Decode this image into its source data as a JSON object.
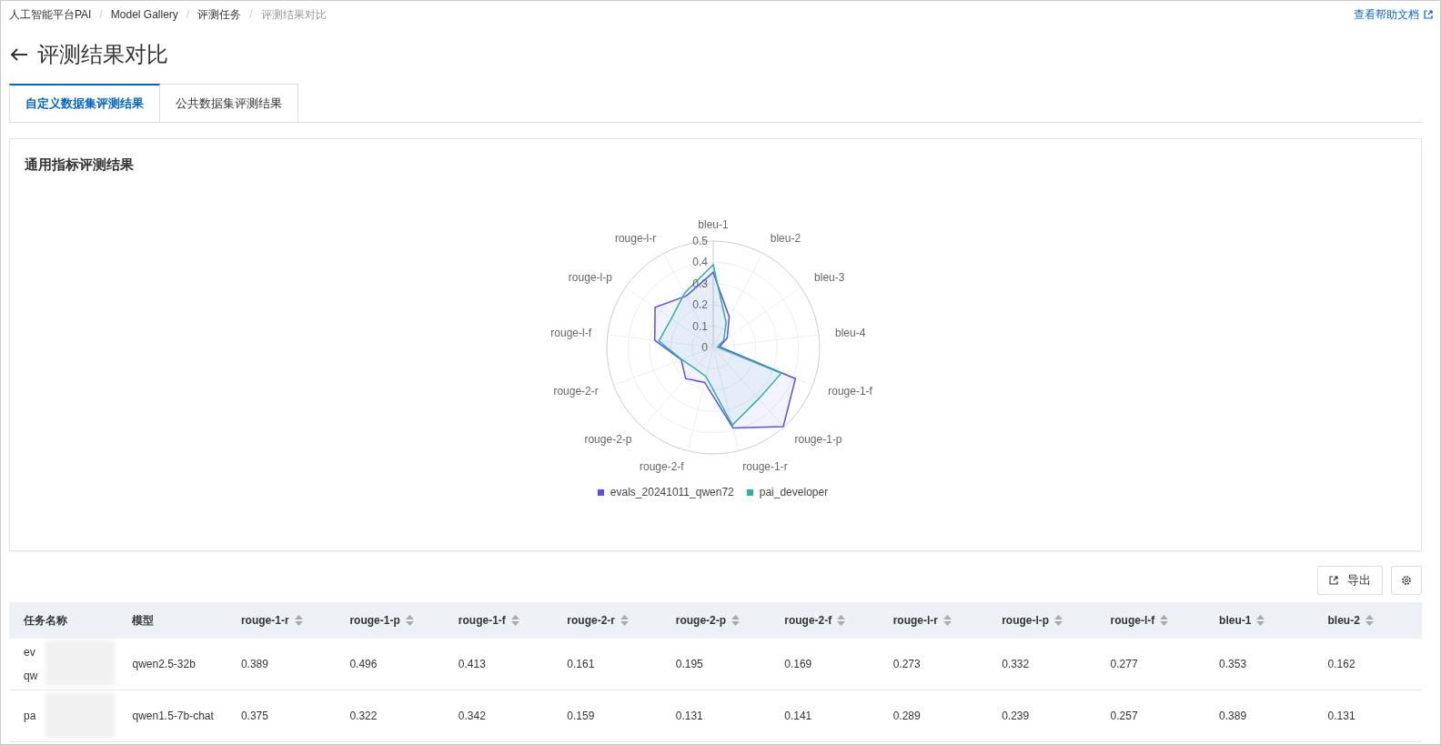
{
  "breadcrumb_separator": "/",
  "breadcrumb": [
    {
      "label": "人工智能平台PAI"
    },
    {
      "label": "Model Gallery"
    },
    {
      "label": "评测任务"
    },
    {
      "label": "评测结果对比"
    }
  ],
  "help_link": "查看帮助文档",
  "page_title": "评测结果对比",
  "tabs": [
    {
      "label": "自定义数据集评测结果",
      "selected": true
    },
    {
      "label": "公共数据集评测结果",
      "selected": false
    }
  ],
  "card": {
    "title": "通用指标评测结果",
    "chart_data": {
      "type": "radar",
      "legend": "bottom",
      "categories": [
        "bleu-1",
        "bleu-2",
        "bleu-3",
        "bleu-4",
        "rouge-1-f",
        "rouge-1-p",
        "rouge-1-r",
        "rouge-2-f",
        "rouge-2-p",
        "rouge-2-r",
        "rouge-l-f",
        "rouge-l-p",
        "rouge-l-r"
      ],
      "ylim": [
        0,
        0.5
      ],
      "yticks": [
        0,
        0.1,
        0.2,
        0.3,
        0.4,
        0.5
      ],
      "series": [
        {
          "name": "evals_20241011_qwen72",
          "color": "#5b4ff0",
          "values": [
            0.353,
            0.162,
            0.08,
            0.03,
            0.413,
            0.496,
            0.389,
            0.169,
            0.195,
            0.161,
            0.277,
            0.332,
            0.273
          ]
        },
        {
          "name": "pai_developer",
          "color": "#2fb0a4",
          "values": [
            0.389,
            0.131,
            0.06,
            0.02,
            0.342,
            0.322,
            0.375,
            0.141,
            0.131,
            0.159,
            0.257,
            0.239,
            0.289
          ]
        }
      ]
    }
  },
  "toolbar": {
    "export_label": "导出"
  },
  "table": {
    "columns": [
      {
        "label": "任务名称",
        "sortable": false
      },
      {
        "label": "模型",
        "sortable": false
      },
      {
        "label": "rouge-1-r",
        "sortable": true
      },
      {
        "label": "rouge-1-p",
        "sortable": true
      },
      {
        "label": "rouge-1-f",
        "sortable": true
      },
      {
        "label": "rouge-2-r",
        "sortable": true
      },
      {
        "label": "rouge-2-p",
        "sortable": true
      },
      {
        "label": "rouge-2-f",
        "sortable": true
      },
      {
        "label": "rouge-l-r",
        "sortable": true
      },
      {
        "label": "rouge-l-p",
        "sortable": true
      },
      {
        "label": "rouge-l-f",
        "sortable": true
      },
      {
        "label": "bleu-1",
        "sortable": true
      },
      {
        "label": "bleu-2",
        "sortable": true
      }
    ],
    "rows": [
      {
        "task_lines": [
          "ev",
          "qw"
        ],
        "model": "qwen2.5-32b",
        "values": [
          "0.389",
          "0.496",
          "0.413",
          "0.161",
          "0.195",
          "0.169",
          "0.273",
          "0.332",
          "0.277",
          "0.353",
          "0.162"
        ]
      },
      {
        "task_lines": [
          "pa"
        ],
        "model": "qwen1.5-7b-chat",
        "values": [
          "0.375",
          "0.322",
          "0.342",
          "0.159",
          "0.131",
          "0.141",
          "0.289",
          "0.239",
          "0.257",
          "0.389",
          "0.131"
        ]
      }
    ]
  }
}
